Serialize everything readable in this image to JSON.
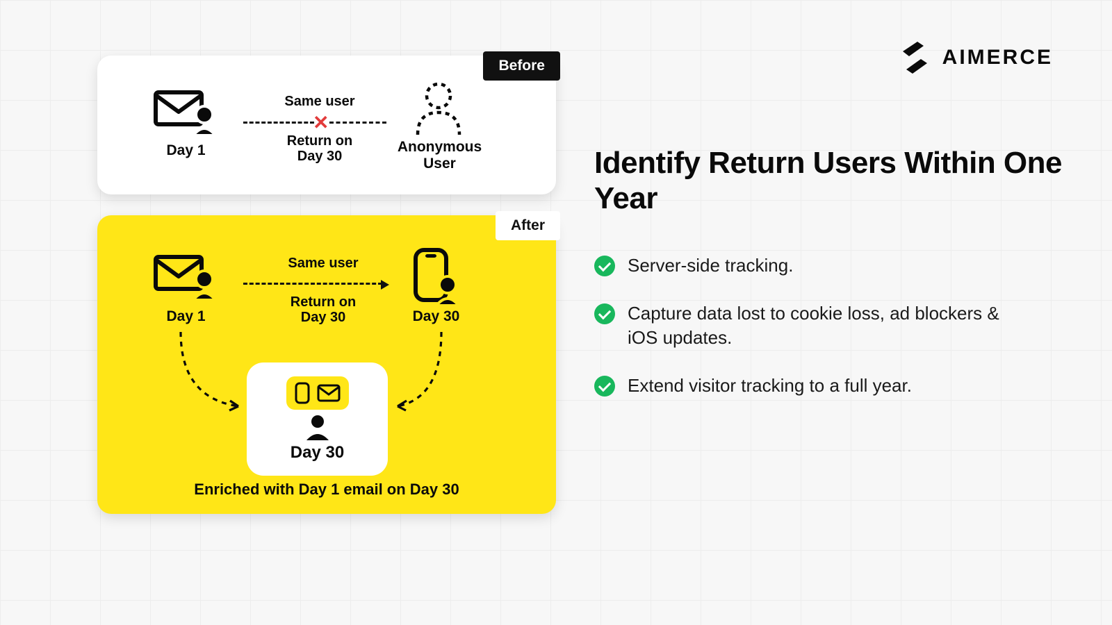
{
  "brand": {
    "name": "AIMERCE"
  },
  "heading": "Identify Return Users Within One Year",
  "bullets": [
    "Server-side tracking.",
    "Capture data lost to cookie loss, ad blockers & iOS updates.",
    "Extend visitor tracking to a full year."
  ],
  "before": {
    "tag": "Before",
    "left_label": "Day 1",
    "mid_top": "Same user",
    "mid_bottom": "Return on\nDay 30",
    "right_label": "Anonymous\nUser"
  },
  "after": {
    "tag": "After",
    "left_label": "Day 1",
    "mid_top": "Same user",
    "mid_bottom": "Return on\nDay 30",
    "right_label": "Day 30",
    "inset_label": "Day 30",
    "enriched": "Enriched with Day 1 email on Day 30"
  }
}
